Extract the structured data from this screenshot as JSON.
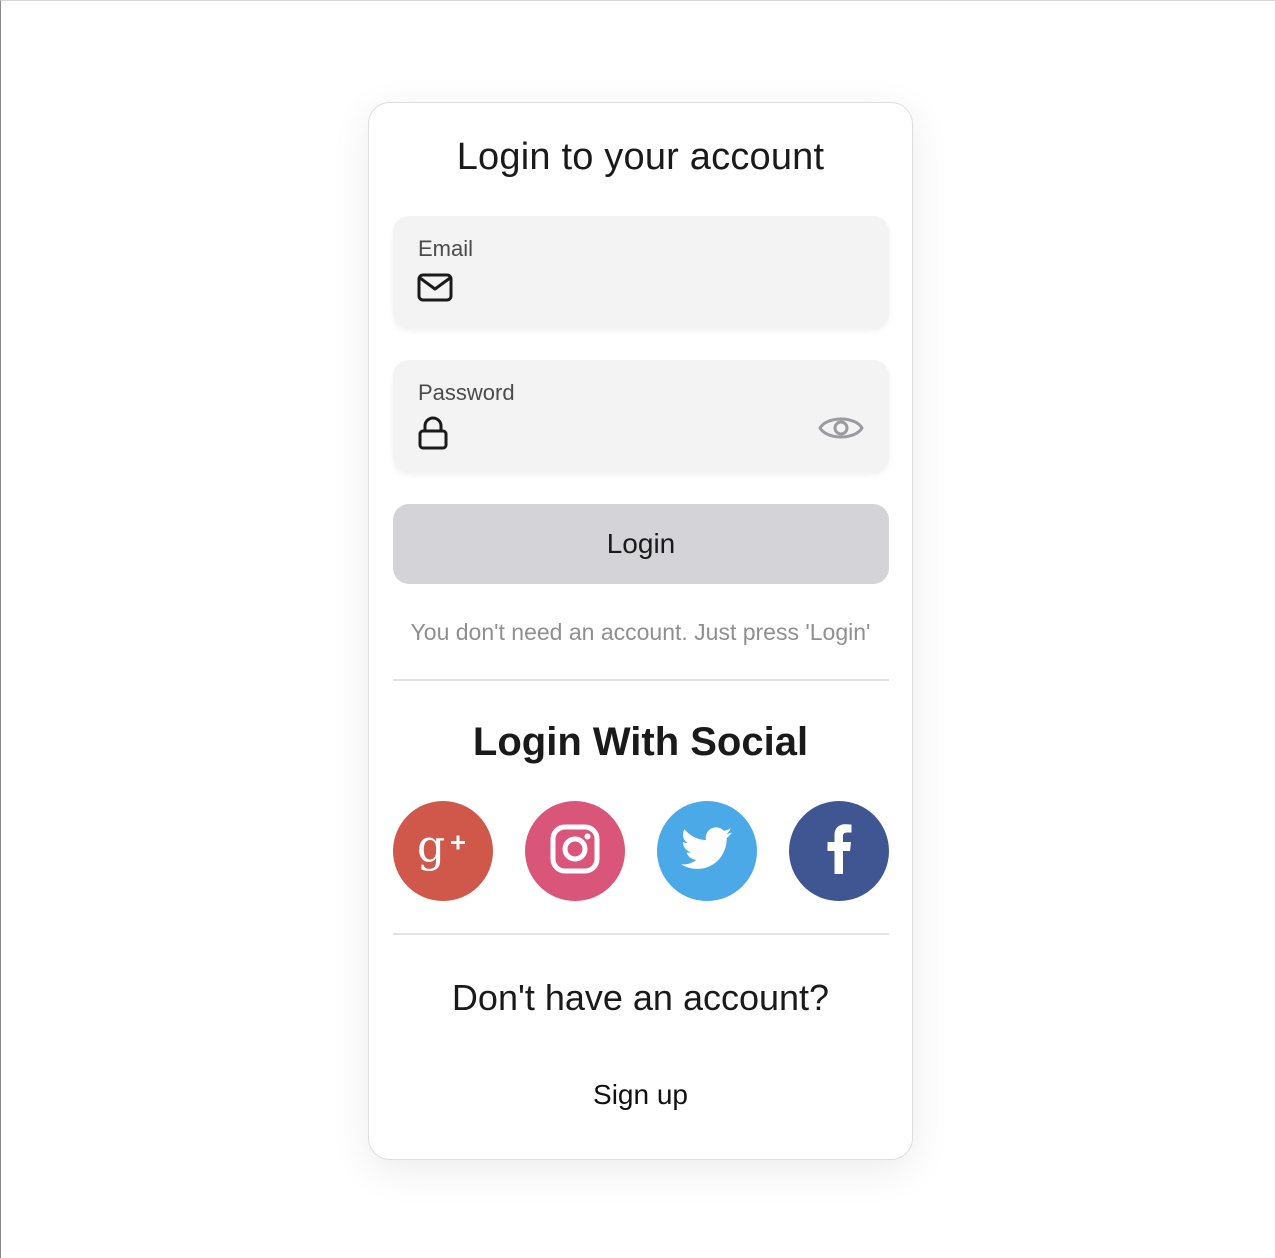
{
  "form": {
    "title": "Login to your account",
    "email": {
      "label": "Email",
      "value": "",
      "placeholder": ""
    },
    "password": {
      "label": "Password",
      "value": "",
      "placeholder": ""
    },
    "login_button": "Login",
    "hint": "You don't need an account. Just press 'Login'"
  },
  "social": {
    "title": "Login With Social",
    "buttons": [
      {
        "name": "google-plus",
        "color": "#d0584a"
      },
      {
        "name": "instagram",
        "color": "#d95579"
      },
      {
        "name": "twitter",
        "color": "#4aa9e6"
      },
      {
        "name": "facebook",
        "color": "#405692"
      }
    ]
  },
  "signup": {
    "question": "Don't have an account?",
    "link": "Sign up"
  },
  "colors": {
    "field_bg": "#f3f3f4",
    "button_bg": "#d4d4d8",
    "hint_text": "#8f8f8f",
    "eye_icon": "#9a9aa0"
  }
}
